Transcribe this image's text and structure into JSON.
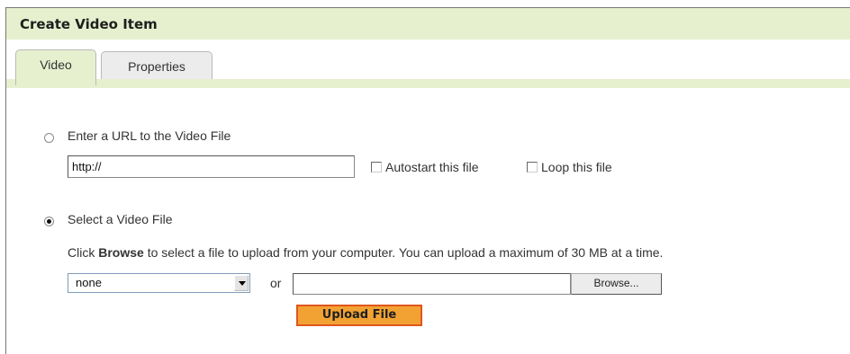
{
  "panel": {
    "title": "Create Video Item"
  },
  "tabs": [
    {
      "label": "Video",
      "active": true
    },
    {
      "label": "Properties",
      "active": false
    }
  ],
  "url_option": {
    "label": "Enter a URL to the Video File",
    "selected": false,
    "url_value": "http://",
    "autostart_label": "Autostart this file",
    "loop_label": "Loop this file"
  },
  "file_option": {
    "label": "Select a Video File",
    "selected": true,
    "instructions_prefix": "Click ",
    "instructions_bold": "Browse",
    "instructions_suffix": " to select a file to upload from your computer. You can upload a maximum of 30 MB at a time.",
    "dropdown_value": "none",
    "or_label": "or",
    "browse_label": "Browse...",
    "upload_label": "Upload File"
  },
  "colors": {
    "panel_bg": "#e6f0cf",
    "upload_bg": "#f2a233",
    "upload_border": "#e0561c"
  }
}
